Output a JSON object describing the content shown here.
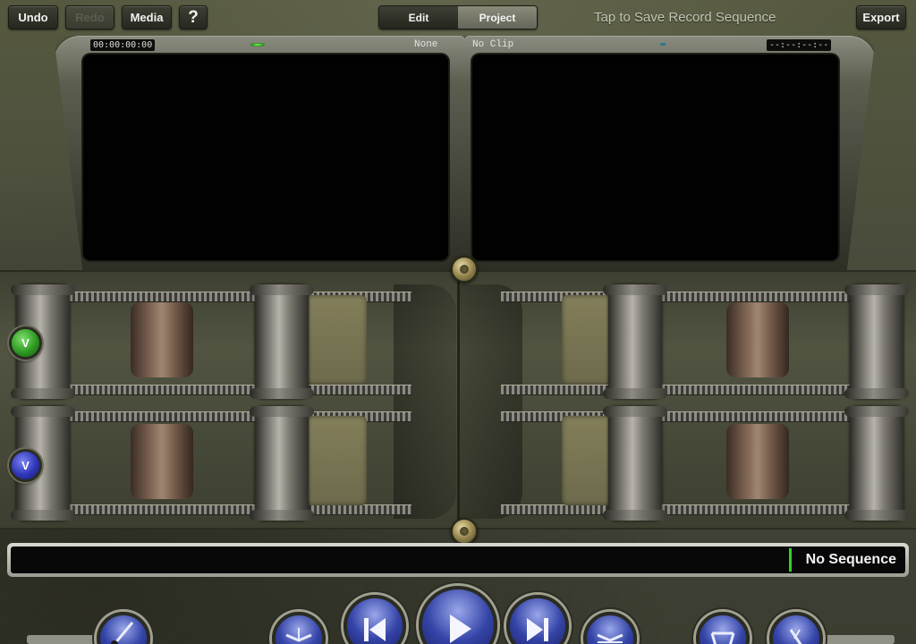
{
  "toolbar": {
    "undo_label": "Undo",
    "redo_label": "Redo",
    "media_label": "Media",
    "help_label": "?",
    "export_label": "Export",
    "save_hint": "Tap to Save Record Sequence"
  },
  "mode_tabs": [
    {
      "label": "Edit",
      "selected": false
    },
    {
      "label": "Project",
      "selected": true
    }
  ],
  "source_monitor": {
    "timecode": "00:00:00:00",
    "clip_name": "None"
  },
  "record_monitor": {
    "clip_name": "No Clip",
    "timecode": "--:--:--:--"
  },
  "tracks": [
    {
      "label": "V",
      "color": "#2d9a22"
    },
    {
      "label": "V",
      "color": "#2f36b8"
    }
  ],
  "sequence_bar": {
    "label": "No Sequence"
  },
  "transport_icons": [
    "brush-icon",
    "splice-icon",
    "previous-edit-icon",
    "play-icon",
    "next-edit-icon",
    "overwrite-icon",
    "lift-icon",
    "extract-icon"
  ]
}
